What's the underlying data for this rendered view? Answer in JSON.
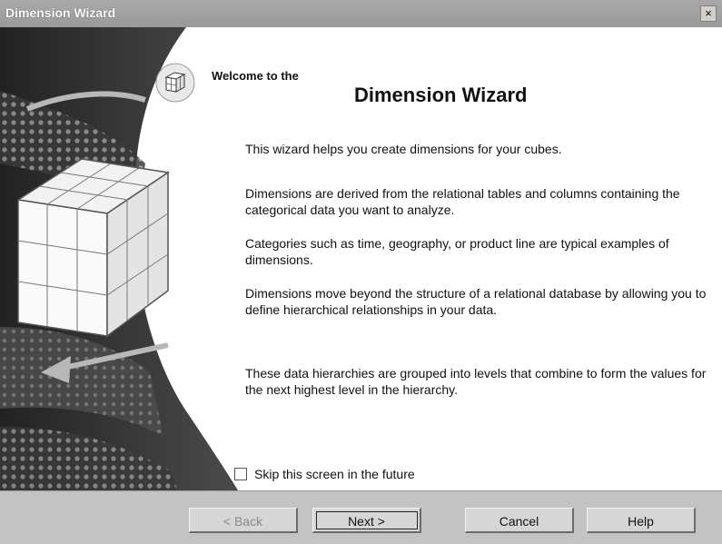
{
  "window": {
    "title": "Dimension Wizard",
    "close_glyph": "×"
  },
  "header": {
    "welcome": "Welcome to the",
    "title": "Dimension Wizard"
  },
  "paragraphs": [
    "This wizard helps you create dimensions for your cubes.",
    "Dimensions are derived from the relational tables and columns containing the categorical data you want to analyze.",
    "Categories such as time, geography, or product line are typical examples of dimensions.",
    "Dimensions move beyond the structure of a relational database by allowing you to define hierarchical relationships in your data.",
    "These data hierarchies are grouped into levels that combine to form the values for the next highest level in the hierarchy."
  ],
  "skip": {
    "label": "Skip this screen in the future",
    "checked": false,
    "accesskey": "S"
  },
  "buttons": {
    "back": {
      "label": "< Back",
      "enabled": false
    },
    "next": {
      "label": "Next >",
      "enabled": true
    },
    "cancel": {
      "label": "Cancel",
      "enabled": true
    },
    "help": {
      "label": "Help",
      "enabled": true
    }
  },
  "icons": {
    "dimension_icon": "dimension-cube-icon",
    "hero": "wireframe-cube-icon"
  }
}
